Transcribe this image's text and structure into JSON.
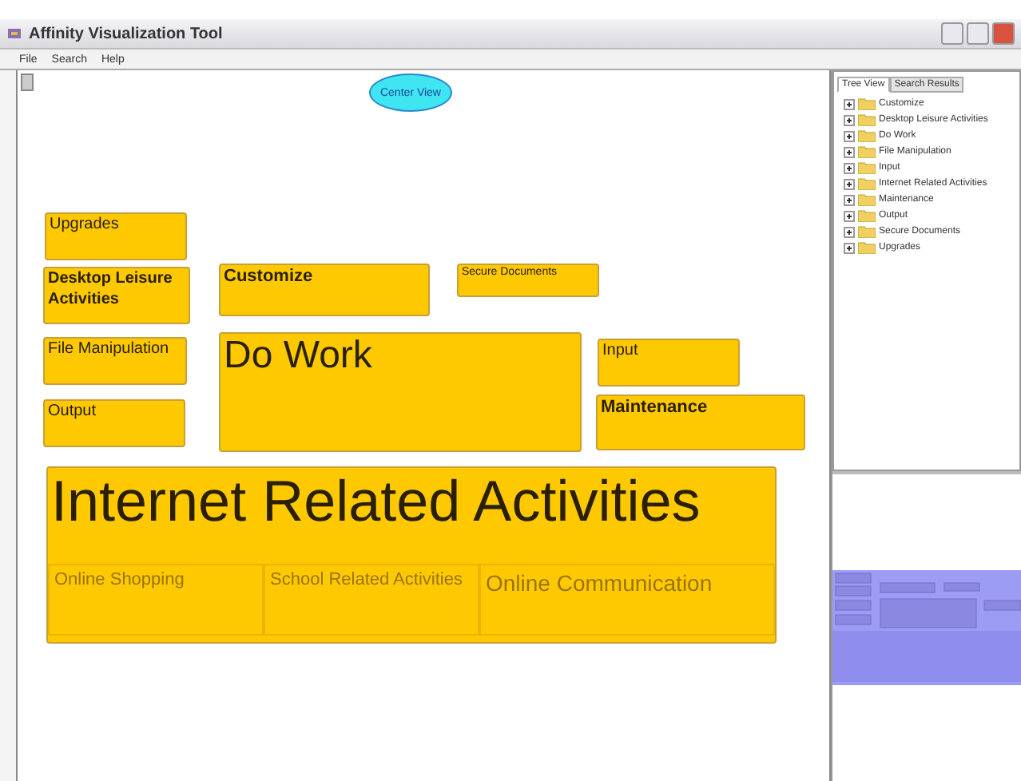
{
  "window": {
    "title": "Affinity Visualization Tool"
  },
  "menu": [
    "File",
    "Search",
    "Help"
  ],
  "center_button": "Center View",
  "groups": [
    {
      "label": "Upgrades"
    },
    {
      "label": "Desktop Leisure Activities"
    },
    {
      "label": "Customize"
    },
    {
      "label": "Secure Documents"
    },
    {
      "label": "File Manipulation"
    },
    {
      "label": "Do Work"
    },
    {
      "label": "Input"
    },
    {
      "label": "Output"
    },
    {
      "label": "Maintenance"
    },
    {
      "label": "Internet Related Activities",
      "children": [
        {
          "label": "Online Shopping"
        },
        {
          "label": "School Related Activities"
        },
        {
          "label": "Online Communication"
        }
      ]
    }
  ],
  "tabs": [
    {
      "label": "Tree View",
      "selected": true
    },
    {
      "label": "Search Results",
      "selected": false
    }
  ],
  "tree": [
    {
      "label": "Customize",
      "expanded": false
    },
    {
      "label": "Desktop Leisure Activities",
      "expanded": false
    },
    {
      "label": "Do Work",
      "expanded": false
    },
    {
      "label": "File Manipulation",
      "expanded": false
    },
    {
      "label": "Input",
      "expanded": false
    },
    {
      "label": "Internet Related Activities",
      "expanded": false
    },
    {
      "label": "Maintenance",
      "expanded": false
    },
    {
      "label": "Output",
      "expanded": false
    },
    {
      "label": "Secure Documents",
      "expanded": false
    },
    {
      "label": "Upgrades",
      "expanded": false
    }
  ]
}
